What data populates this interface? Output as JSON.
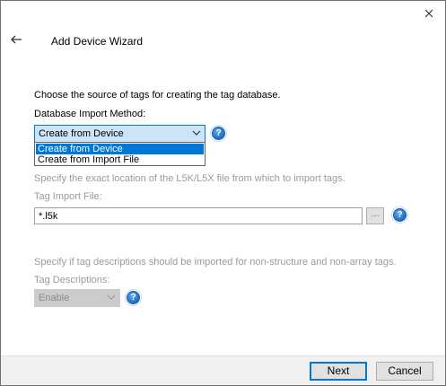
{
  "window": {
    "title": "Add Device Wizard"
  },
  "instructions": {
    "source_prompt": "Choose the source of tags for creating the tag database.",
    "method_label": "Database Import Method:",
    "location_prompt": "Specify the exact location of the L5K/L5X file from which to import tags.",
    "file_label": "Tag Import File:",
    "desc_prompt": "Specify if tag descriptions should be imported for non-structure and non-array tags.",
    "desc_label": "Tag Descriptions:"
  },
  "import_method": {
    "selected": "Create from Device",
    "options": [
      "Create from Device",
      "Create from Import File"
    ]
  },
  "tag_import_file": {
    "value": "*.l5k",
    "browse_label": "..."
  },
  "tag_descriptions": {
    "selected": "Enable"
  },
  "help": {
    "glyph": "?"
  },
  "buttons": {
    "next": "Next",
    "cancel": "Cancel"
  },
  "colors": {
    "accent": "#0078d7",
    "disabled_text": "#9a9a9a"
  }
}
